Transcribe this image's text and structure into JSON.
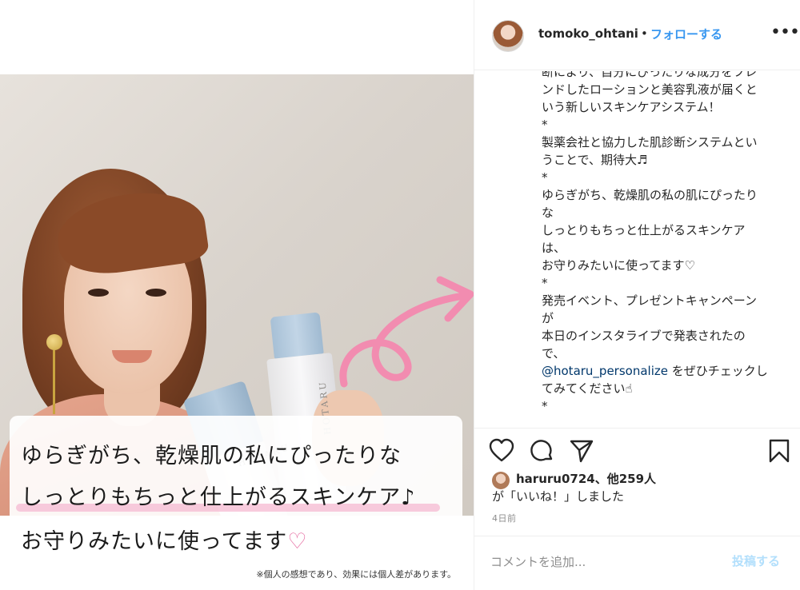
{
  "post_image": {
    "overlay_line1": "ゆらぎがち、乾燥肌の私にぴったりな",
    "overlay_line2": "しっとりもちっと仕上がるスキンケア♪",
    "overlay_line3": "お守りみたいに使ってます",
    "overlay_heart": "♡",
    "disclaimer": "※個人の感想であり、効果には個人差があります。",
    "product_brand": "HOTARU"
  },
  "header": {
    "username": "tomoko_ohtani",
    "separator": "•",
    "follow_label": "フォローする",
    "more_label": "•••"
  },
  "caption": {
    "lines": [
      "断により、自分にぴったりな成分をフレ",
      "ンドしたローションと美容乳液が届くと",
      "いう新しいスキンケアシステム！",
      "*",
      "製薬会社と協力した肌診断システムとい",
      "うことで、期待大♬",
      "*",
      "ゆらぎがち、乾燥肌の私の肌にぴったり",
      "な",
      "しっとりもちっと仕上がるスキンケア",
      "は、",
      "お守りみたいに使ってます♡",
      "*",
      "発売イベント、プレゼントキャンペーン",
      "が",
      "本日のインスタライブで発表されたの",
      "で、"
    ],
    "mention": "@hotaru_personalize",
    "mention_suffix": " をぜひチェックし",
    "tail_lines": [
      "てみてください☝",
      "*"
    ]
  },
  "actions": {
    "like_icon": "heart-outline-icon",
    "comment_icon": "comment-bubble-icon",
    "share_icon": "paper-plane-icon",
    "save_icon": "bookmark-icon"
  },
  "likes": {
    "first_liker": "haruru0724",
    "others": "、他259人",
    "suffix": "が「いいね！」しました"
  },
  "timestamp": "4日前",
  "comment": {
    "placeholder": "コメントを追加...",
    "post_label": "投稿する"
  },
  "colors": {
    "link_blue": "#3897f0",
    "post_disabled": "#b2dffc",
    "arrow_pink": "#f28cb0",
    "highlight_pink": "#f5b9d2"
  }
}
